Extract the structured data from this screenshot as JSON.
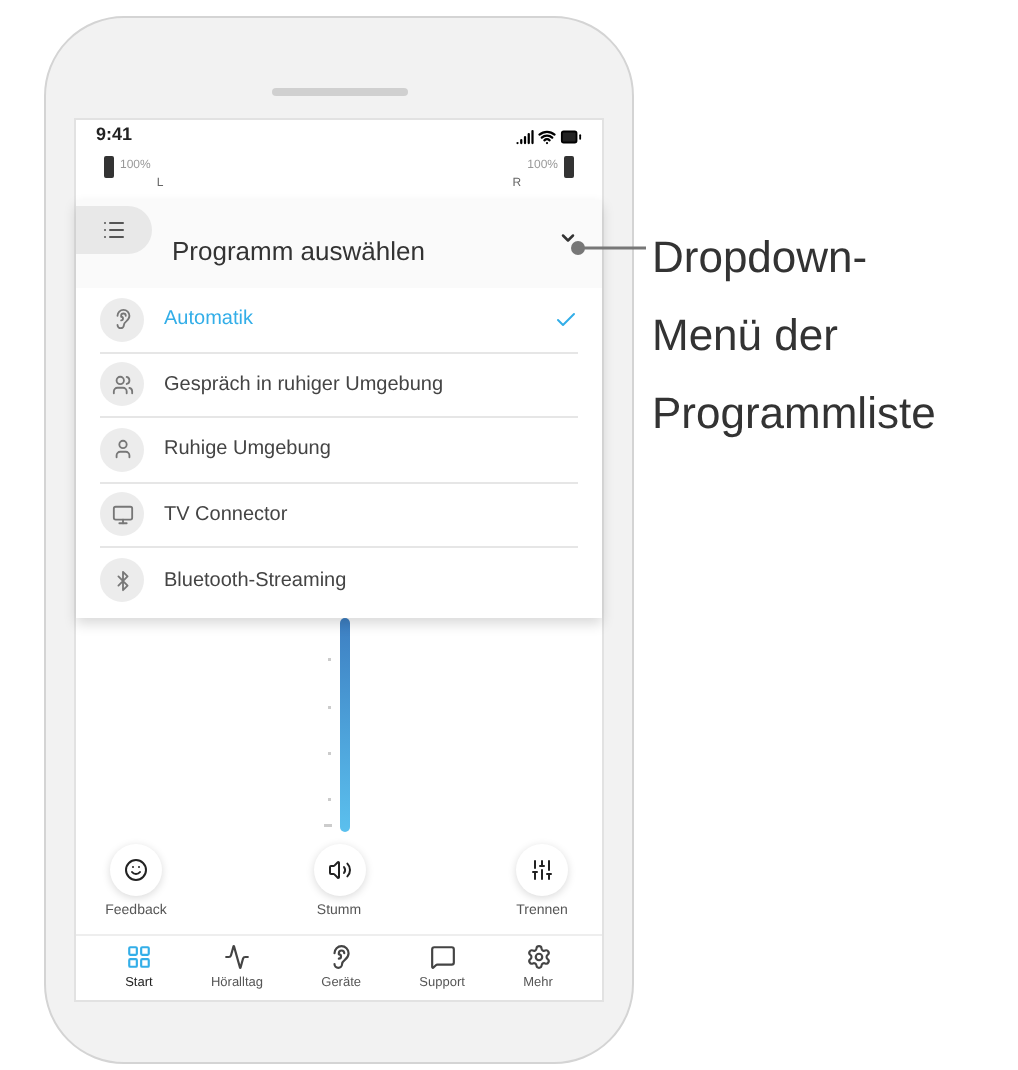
{
  "status_bar": {
    "time": "9:41"
  },
  "batteries": [
    {
      "percent": "100%",
      "side": "L"
    },
    {
      "percent": "100%",
      "side": "R"
    }
  ],
  "dropdown": {
    "title": "Programm auswählen",
    "expanded": true,
    "items": [
      {
        "kind": "auto",
        "label": "Automatik",
        "selected": true
      },
      {
        "kind": "conversation",
        "label": "Gespräch in ruhiger Umgebung",
        "selected": false
      },
      {
        "kind": "quiet",
        "label": "Ruhige Umgebung",
        "selected": false
      },
      {
        "kind": "tv",
        "label": "TV Connector",
        "selected": false
      },
      {
        "kind": "bluetooth",
        "label": "Bluetooth-Streaming",
        "selected": false
      }
    ]
  },
  "actions": [
    {
      "kind": "feedback",
      "label": "Feedback"
    },
    {
      "kind": "mute",
      "label": "Stumm"
    },
    {
      "kind": "split",
      "label": "Trennen"
    }
  ],
  "tabs": [
    {
      "kind": "start",
      "label": "Start",
      "selected": true
    },
    {
      "kind": "day",
      "label": "Höralltag",
      "selected": false
    },
    {
      "kind": "devices",
      "label": "Geräte",
      "selected": false
    },
    {
      "kind": "support",
      "label": "Support",
      "selected": false
    },
    {
      "kind": "more",
      "label": "Mehr",
      "selected": false
    }
  ],
  "callout": {
    "lines": [
      "Dropdown-",
      "Menü der",
      "Programmliste"
    ]
  }
}
